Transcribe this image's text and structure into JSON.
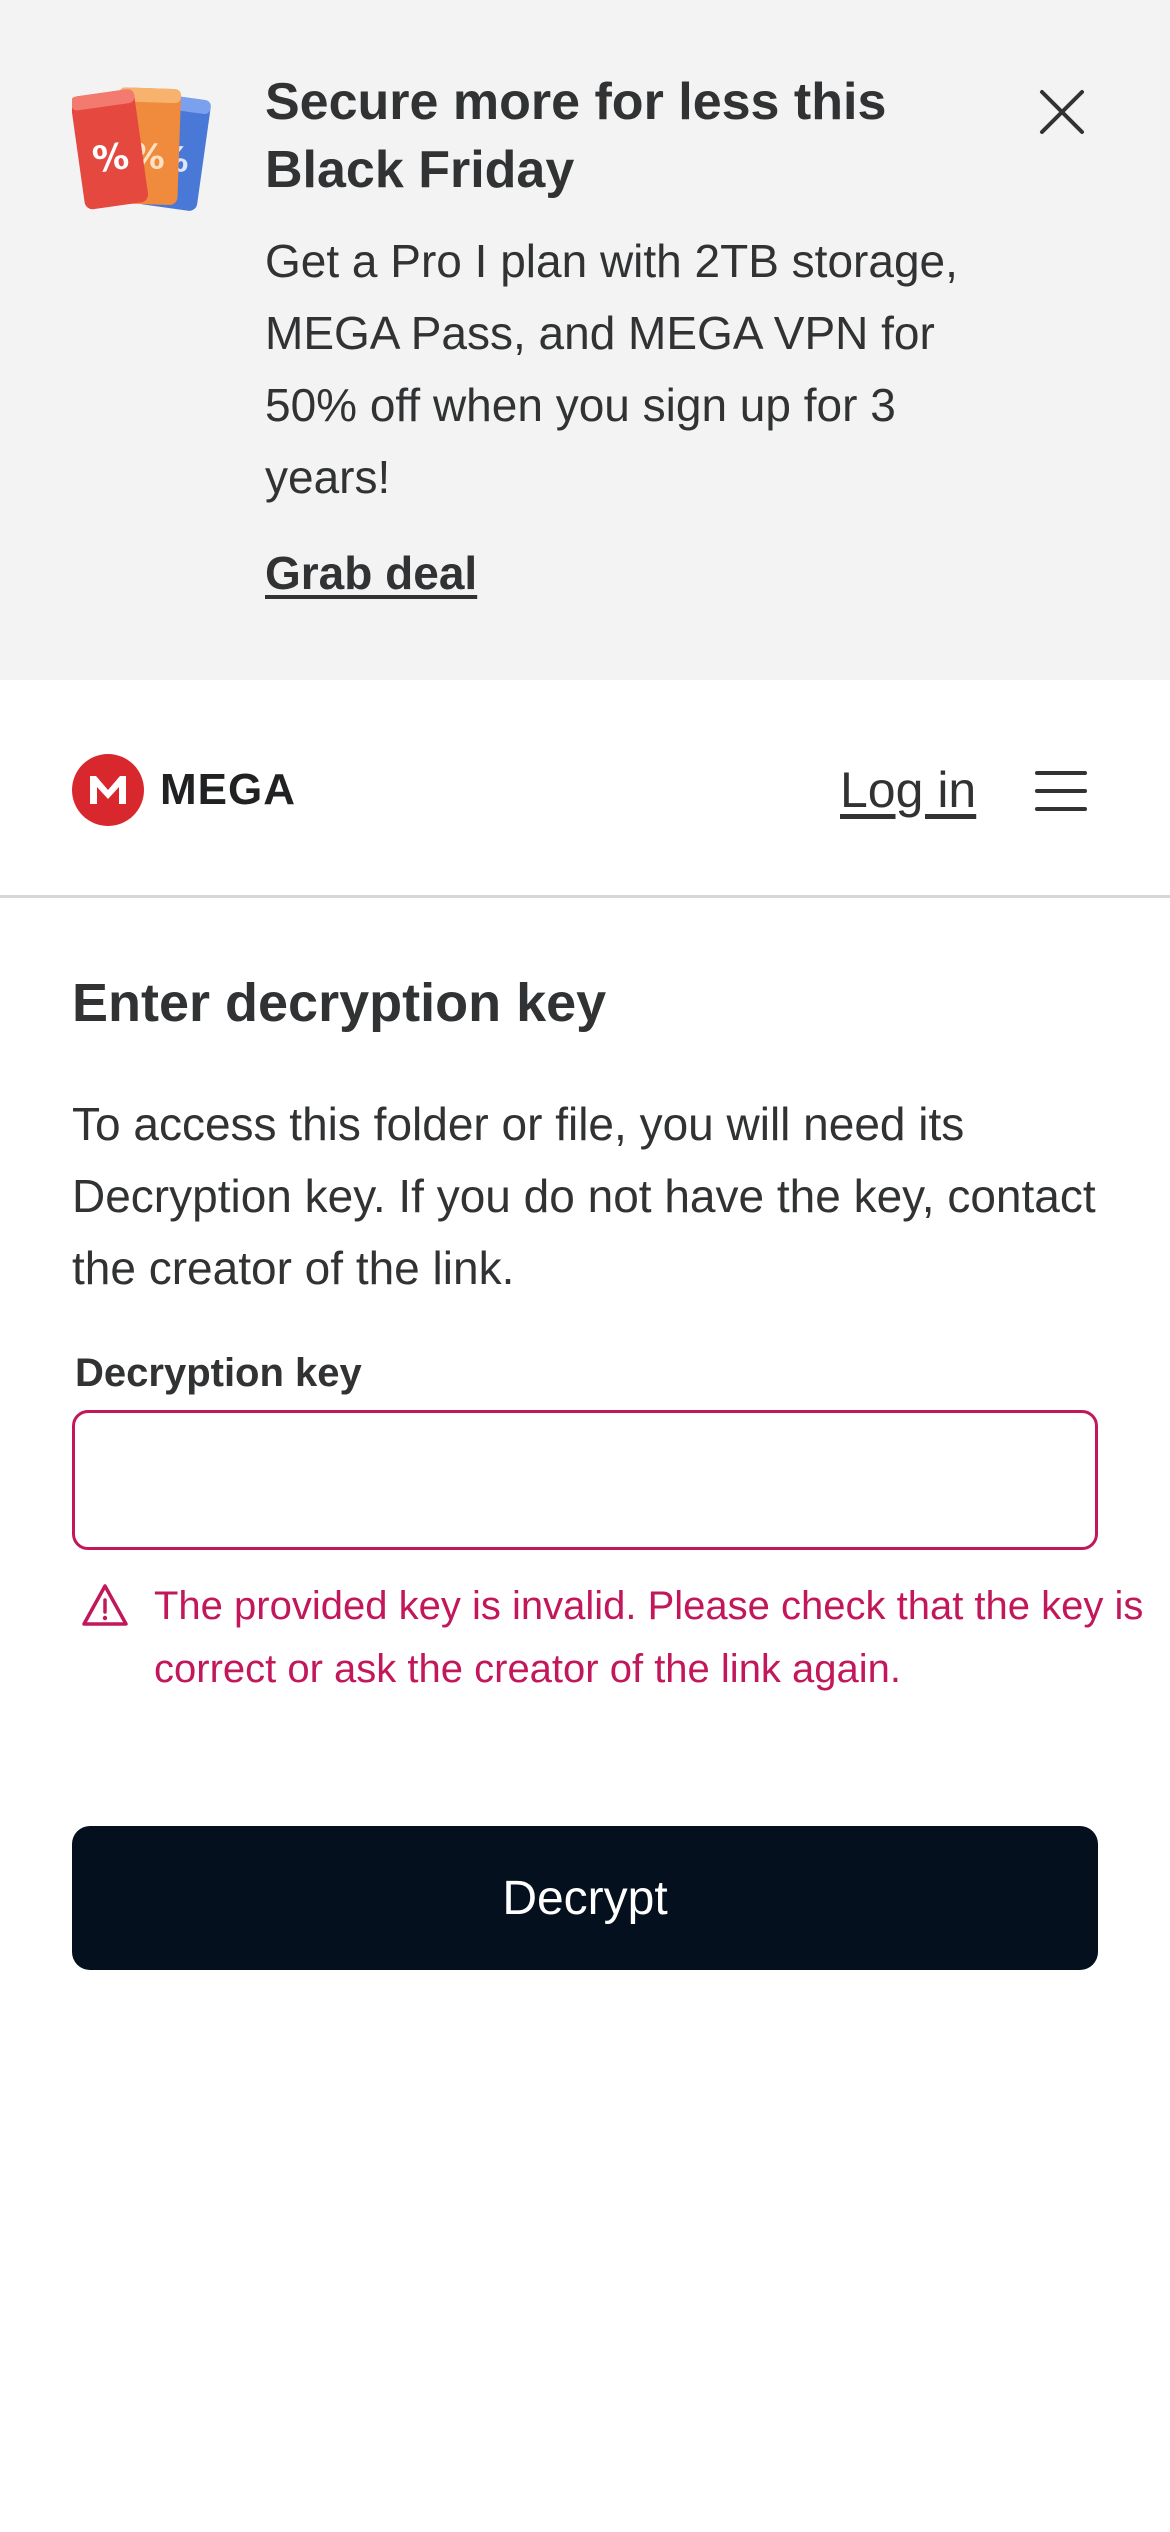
{
  "promo": {
    "title": "Secure more for less this Black Friday",
    "body": "Get a Pro I plan with 2TB storage, MEGA Pass, and MEGA VPN for 50% off when you sign up for 3 years!",
    "cta": "Grab deal",
    "icon": "discount-tickets-icon",
    "close_icon": "close-icon",
    "background_color": "#f3f3f3"
  },
  "header": {
    "brand": "MEGA",
    "brand_color": "#d9272e",
    "login": "Log in",
    "menu_icon": "hamburger-menu-icon"
  },
  "main": {
    "title": "Enter decryption key",
    "description": "To access this folder or file, you will need its Decryption key. If you do not have the key, contact the creator of the link.",
    "field_label": "Decryption key",
    "field_value": "",
    "field_placeholder": "",
    "error": "The provided key is invalid. Please check that the key is correct or ask the creator of the link again.",
    "error_color": "#c2185b",
    "error_icon": "warning-triangle-icon",
    "decrypt_label": "Decrypt",
    "button_color": "#04101d"
  }
}
